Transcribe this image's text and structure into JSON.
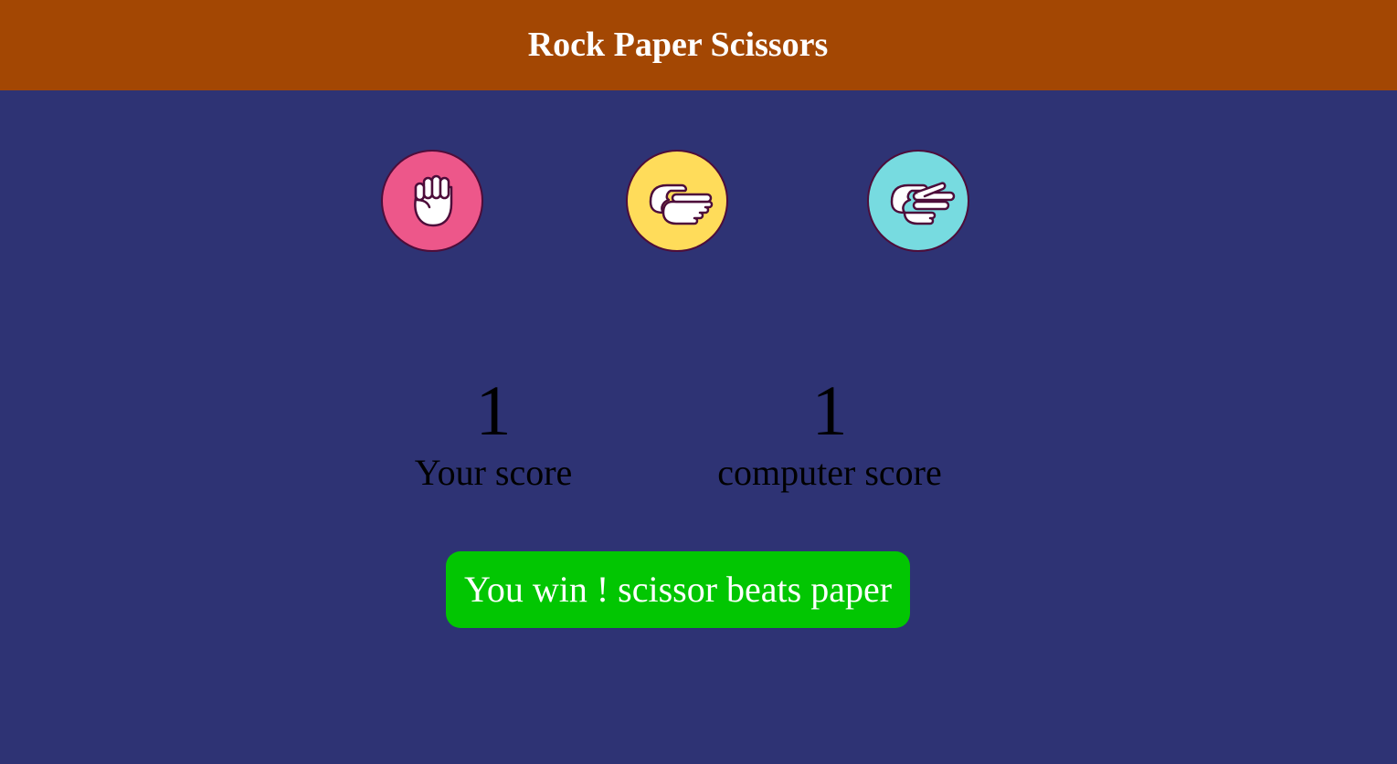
{
  "header": {
    "title": "Rock Paper Scissors",
    "background_color": "#a34703"
  },
  "choices": [
    {
      "name": "rock",
      "icon": "fist-icon",
      "color": "#ed578a"
    },
    {
      "name": "paper",
      "icon": "flat-hand-icon",
      "color": "#ffdc5a"
    },
    {
      "name": "scissors",
      "icon": "two-finger-hand-icon",
      "color": "#77dbe0"
    }
  ],
  "scores": {
    "user": {
      "value": "1",
      "label": "Your score"
    },
    "computer": {
      "value": "1",
      "label": "computer score"
    }
  },
  "message": {
    "text": "You win ! scissor beats paper",
    "color": "#02c602"
  },
  "page_background": "#2e3374"
}
